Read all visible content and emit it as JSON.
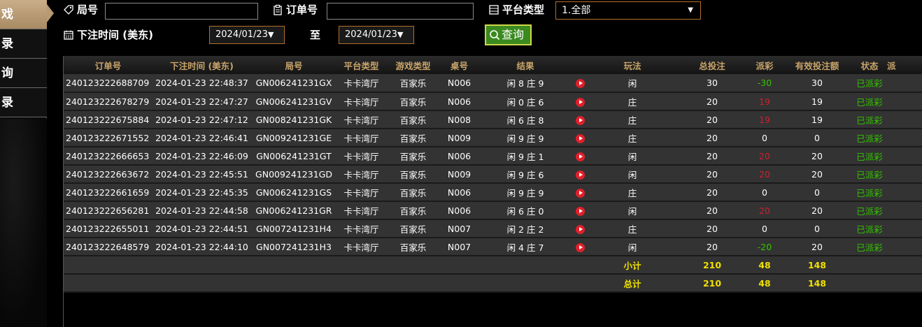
{
  "sidebar": {
    "items": [
      {
        "label": "戏",
        "active": true
      },
      {
        "label": "录",
        "active": false
      },
      {
        "label": "询",
        "active": false
      },
      {
        "label": "录",
        "active": false
      }
    ]
  },
  "filters": {
    "round_label": "局号",
    "round_value": "",
    "order_label": "订单号",
    "order_value": "",
    "platform_label": "平台类型",
    "platform_selected": "1.全部",
    "time_label": "下注时间 (美东)",
    "date_from": "2024/01/23",
    "to_label": "至",
    "date_to": "2024/01/23",
    "query_label": "查询"
  },
  "table": {
    "headers": [
      "订单号",
      "下注时间 (美东)",
      "局号",
      "平台类型",
      "游戏类型",
      "桌号",
      "结果",
      "",
      "玩法",
      "总投注",
      "派彩",
      "有效投注额",
      "状态",
      "派"
    ],
    "rows": [
      {
        "order": "240123222688709",
        "time": "2024-01-23 22:48:37",
        "round": "GN006241231GX",
        "platform": "卡卡湾厅",
        "game": "百家乐",
        "table": "N006",
        "result": "闲 8 庄 9",
        "play": "闲",
        "bet": "30",
        "payout": "-30",
        "payout_color": "pos",
        "valid": "30",
        "status": "已派彩"
      },
      {
        "order": "240123222678279",
        "time": "2024-01-23 22:47:27",
        "round": "GN006241231GV",
        "platform": "卡卡湾厅",
        "game": "百家乐",
        "table": "N006",
        "result": "闲 0 庄 6",
        "play": "庄",
        "bet": "20",
        "payout": "19",
        "payout_color": "neg",
        "valid": "19",
        "status": "已派彩"
      },
      {
        "order": "240123222675884",
        "time": "2024-01-23 22:47:12",
        "round": "GN008241231GK",
        "platform": "卡卡湾厅",
        "game": "百家乐",
        "table": "N008",
        "result": "闲 6 庄 8",
        "play": "庄",
        "bet": "20",
        "payout": "19",
        "payout_color": "neg",
        "valid": "19",
        "status": "已派彩"
      },
      {
        "order": "240123222671552",
        "time": "2024-01-23 22:46:41",
        "round": "GN009241231GE",
        "platform": "卡卡湾厅",
        "game": "百家乐",
        "table": "N009",
        "result": "闲 9 庄 9",
        "play": "庄",
        "bet": "20",
        "payout": "0",
        "payout_color": "",
        "valid": "0",
        "status": "已派彩"
      },
      {
        "order": "240123222666653",
        "time": "2024-01-23 22:46:09",
        "round": "GN006241231GT",
        "platform": "卡卡湾厅",
        "game": "百家乐",
        "table": "N006",
        "result": "闲 9 庄 1",
        "play": "闲",
        "bet": "20",
        "payout": "20",
        "payout_color": "neg",
        "valid": "20",
        "status": "已派彩"
      },
      {
        "order": "240123222663672",
        "time": "2024-01-23 22:45:51",
        "round": "GN009241231GD",
        "platform": "卡卡湾厅",
        "game": "百家乐",
        "table": "N009",
        "result": "闲 9 庄 6",
        "play": "闲",
        "bet": "20",
        "payout": "20",
        "payout_color": "neg",
        "valid": "20",
        "status": "已派彩"
      },
      {
        "order": "240123222661659",
        "time": "2024-01-23 22:45:35",
        "round": "GN006241231GS",
        "platform": "卡卡湾厅",
        "game": "百家乐",
        "table": "N006",
        "result": "闲 9 庄 9",
        "play": "庄",
        "bet": "20",
        "payout": "0",
        "payout_color": "",
        "valid": "0",
        "status": "已派彩"
      },
      {
        "order": "240123222656281",
        "time": "2024-01-23 22:44:58",
        "round": "GN006241231GR",
        "platform": "卡卡湾厅",
        "game": "百家乐",
        "table": "N006",
        "result": "闲 6 庄 0",
        "play": "闲",
        "bet": "20",
        "payout": "20",
        "payout_color": "neg",
        "valid": "20",
        "status": "已派彩"
      },
      {
        "order": "240123222655011",
        "time": "2024-01-23 22:44:51",
        "round": "GN007241231H4",
        "platform": "卡卡湾厅",
        "game": "百家乐",
        "table": "N007",
        "result": "闲 2 庄 2",
        "play": "庄",
        "bet": "20",
        "payout": "0",
        "payout_color": "",
        "valid": "0",
        "status": "已派彩"
      },
      {
        "order": "240123222648579",
        "time": "2024-01-23 22:44:10",
        "round": "GN007241231H3",
        "platform": "卡卡湾厅",
        "game": "百家乐",
        "table": "N007",
        "result": "闲 4 庄 7",
        "play": "闲",
        "bet": "20",
        "payout": "-20",
        "payout_color": "pos",
        "valid": "20",
        "status": "已派彩"
      }
    ],
    "subtotal": {
      "label": "小计",
      "bet": "210",
      "payout": "48",
      "valid": "148"
    },
    "total": {
      "label": "总计",
      "bet": "210",
      "payout": "48",
      "valid": "148"
    }
  },
  "colors": {
    "header_text": "#c8a46a",
    "accent_orange": "#b0702a",
    "status_green": "#34c400",
    "payout_red": "#d02030",
    "sum_yellow": "#f0e000",
    "query_green": "#3b8a20"
  }
}
